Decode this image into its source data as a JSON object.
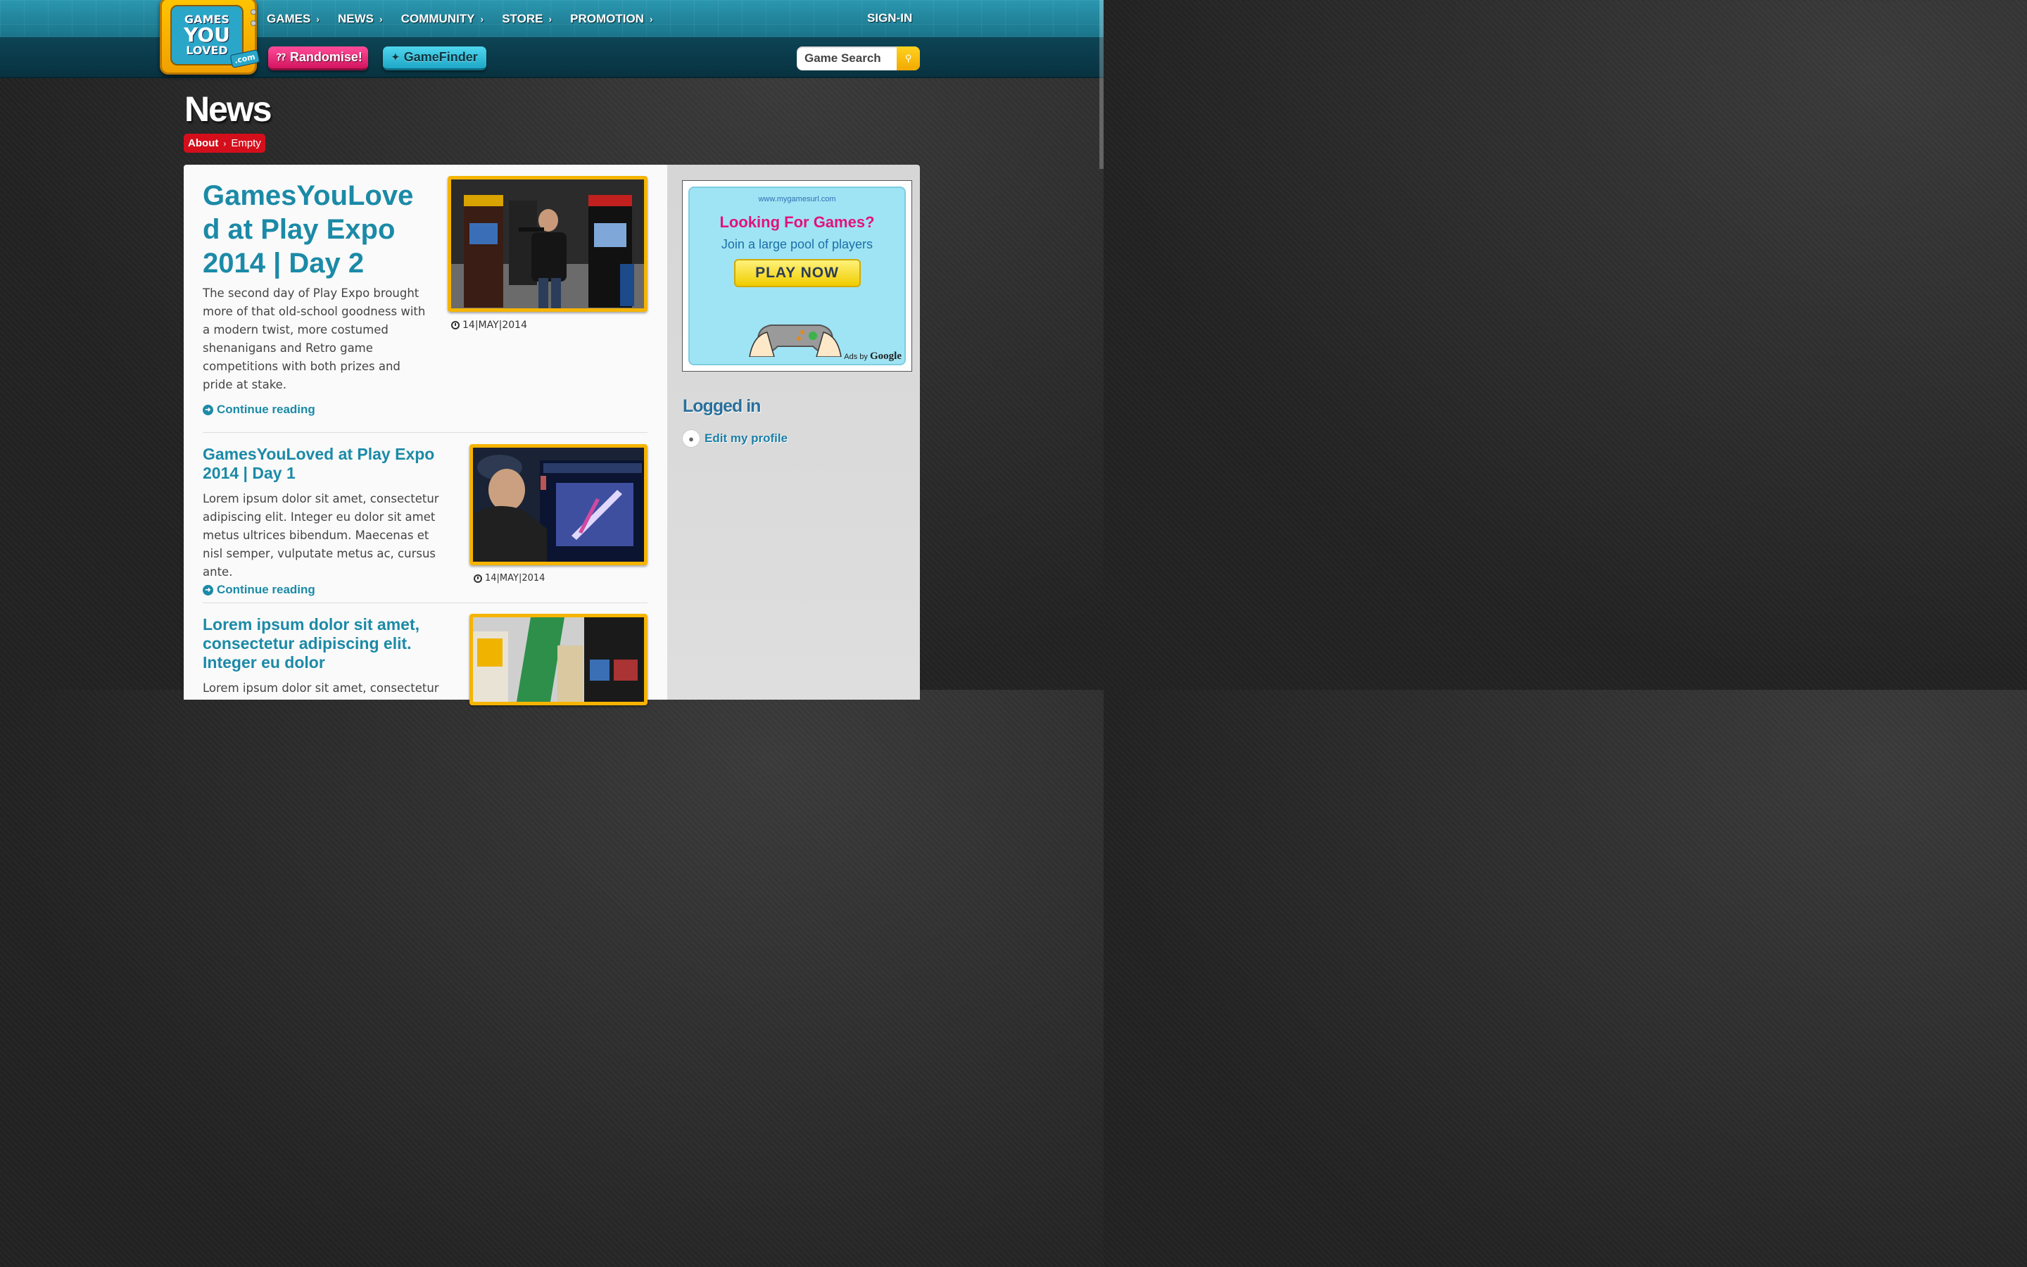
{
  "header": {
    "logo": {
      "line1": "GAMES",
      "line2": "YOU",
      "line3": "LOVED",
      "suffix": ".com"
    },
    "nav": [
      {
        "label": "GAMES"
      },
      {
        "label": "NEWS"
      },
      {
        "label": "COMMUNITY"
      },
      {
        "label": "STORE"
      },
      {
        "label": "PROMOTION"
      }
    ],
    "signin_label": "SIGN-IN",
    "randomise_label": "Randomise!",
    "gamefinder_label": "GameFinder",
    "search": {
      "placeholder": "Game Search",
      "icon": "search-icon"
    }
  },
  "page": {
    "title": "News",
    "breadcrumb": {
      "root": "About",
      "current": "Empty"
    }
  },
  "articles": [
    {
      "title": "GamesYouLoved at Play Expo 2014 | Day 2",
      "title_lines": [
        "GamesYouLove",
        "d at Play Expo",
        "2014 | Day 2"
      ],
      "body": "The second day of Play Expo brought more of that old-school goodness with a modern twist, more costumed shenanigans and Retro game competitions with both prizes and pride at stake.",
      "continue_label": "Continue reading",
      "date": "14|MAY|2014",
      "image_alt": "arcade cabinets with costumed player"
    },
    {
      "title": "GamesYouLoved at Play Expo 2014 | Day 1",
      "body": "Lorem ipsum dolor sit amet, consectetur adipiscing elit. Integer eu dolor sit amet metus ultrices bibendum. Maecenas et nisl semper, vulputate metus ac, cursus ante.",
      "continue_label": "Continue reading",
      "date": "14|MAY|2014",
      "image_alt": "player at Star Wars Trilogy Arcade"
    },
    {
      "title": "Lorem ipsum dolor sit amet, consectetur adipiscing elit. Integer eu dolor",
      "body": "Lorem ipsum dolor sit amet, consectetur",
      "image_alt": "funstock stand at expo"
    }
  ],
  "sidebar": {
    "ad": {
      "url": "www.mygamesurl.com",
      "headline": "Looking For Games?",
      "subline": "Join a large pool of players",
      "button": "PLAY NOW",
      "ads_by": "Ads by",
      "brand": "Google"
    },
    "logged_in_title": "Logged in",
    "edit_profile_label": "Edit my profile"
  },
  "colors": {
    "accent": "#1b8aa7",
    "randomise": "#e81f72",
    "gamefinder": "#2fc0dc",
    "breadcrumb": "#d40f1b",
    "thumb_border": "#f5b400"
  }
}
